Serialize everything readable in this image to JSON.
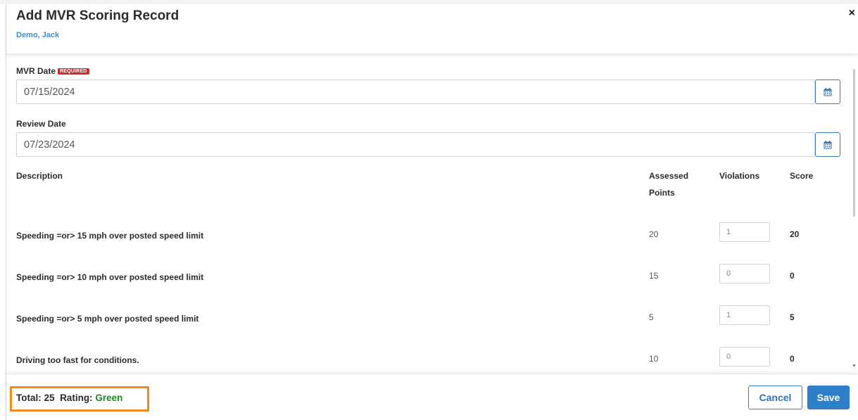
{
  "header": {
    "title": "Add MVR Scoring Record",
    "subtitle": "Demo, Jack",
    "close_label": "×"
  },
  "form": {
    "mvr_date": {
      "label": "MVR Date",
      "required_badge": "REQUIRED",
      "value": "07/15/2024"
    },
    "review_date": {
      "label": "Review Date",
      "value": "07/23/2024"
    }
  },
  "table": {
    "headers": {
      "description": "Description",
      "assessed_line1": "Assessed",
      "assessed_line2": "Points",
      "violations": "Violations",
      "score": "Score"
    },
    "rows": [
      {
        "description": "Speeding =or> 15 mph over posted speed limit",
        "points": "20",
        "violations": "1",
        "score": "20"
      },
      {
        "description": "Speeding =or> 10 mph over posted speed limit",
        "points": "15",
        "violations": "0",
        "score": "0"
      },
      {
        "description": "Speeding =or> 5 mph over posted speed limit",
        "points": "5",
        "violations": "1",
        "score": "5"
      },
      {
        "description": "Driving too fast for conditions.",
        "points": "10",
        "violations": "0",
        "score": "0"
      }
    ]
  },
  "footer": {
    "total_label": "Total:",
    "total_value": "25",
    "rating_label": "Rating:",
    "rating_value": "Green",
    "cancel_label": "Cancel",
    "save_label": "Save"
  },
  "colors": {
    "accent": "#2f7fc8",
    "required": "#c9302c",
    "rating_green": "#1d8a1d",
    "highlight": "#f08a1c"
  },
  "icons": {
    "calendar": "calendar-icon",
    "close": "close-icon"
  }
}
